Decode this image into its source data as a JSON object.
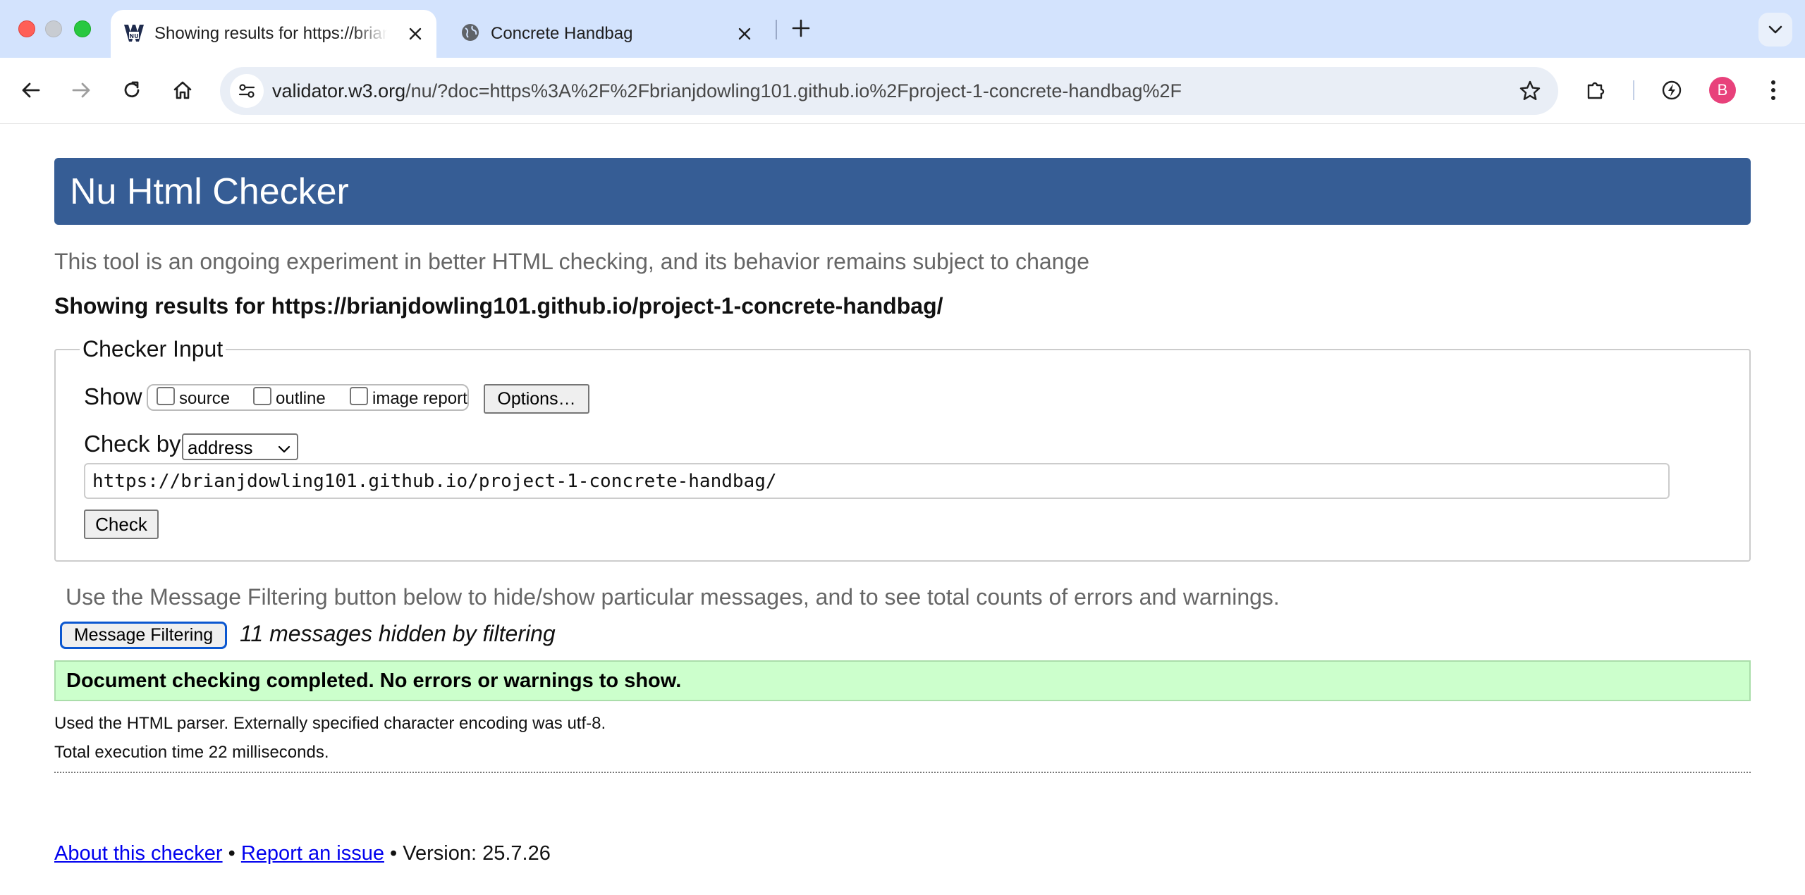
{
  "browser": {
    "tabs": [
      {
        "title": "Showing results for https://brianjdowling101.github.io/project-1-concrete-handbag/",
        "favicon": "w3c-validator-icon",
        "active": true
      },
      {
        "title": "Concrete Handbag",
        "favicon": "globe-icon",
        "active": false
      }
    ],
    "url_host": "validator.w3.org",
    "url_rest": "/nu/?doc=https%3A%2F%2Fbrianjdowling101.github.io%2Fproject-1-concrete-handbag%2F",
    "profile_initial": "B",
    "colors": {
      "tabbar": "#d3e3fd",
      "omnibox": "#e9eef6",
      "avatar": "#e8417b"
    }
  },
  "page": {
    "header_title": "Nu Html Checker",
    "header_color": "#365d95",
    "tagline": "This tool is an ongoing experiment in better HTML checking, and its behavior remains subject to change",
    "results_for": "Showing results for https://brianjdowling101.github.io/project-1-concrete-handbag/",
    "input": {
      "legend": "Checker Input",
      "show_label": "Show",
      "show_options": [
        {
          "label": "source",
          "checked": false
        },
        {
          "label": "outline",
          "checked": false
        },
        {
          "label": "image report",
          "checked": false
        }
      ],
      "options_button": "Options…",
      "check_by_label": "Check by",
      "check_by_value": "address",
      "url_value": "https://brianjdowling101.github.io/project-1-concrete-handbag/",
      "check_button": "Check"
    },
    "filter_note": "Use the Message Filtering button below to hide/show particular messages, and to see total counts of errors and warnings.",
    "filter_button": "Message Filtering",
    "hidden_count": "11 messages hidden by filtering",
    "success_message": "Document checking completed. No errors or warnings to show.",
    "success_color": "#ccffcc",
    "stats": {
      "parser": "Used the HTML parser. Externally specified character encoding was utf-8.",
      "time": "Total execution time 22 milliseconds."
    },
    "footer": {
      "about_link": "About this checker",
      "sep1": " • ",
      "report_link": "Report an issue",
      "sep2": " • ",
      "version": "Version: 25.7.26"
    }
  }
}
